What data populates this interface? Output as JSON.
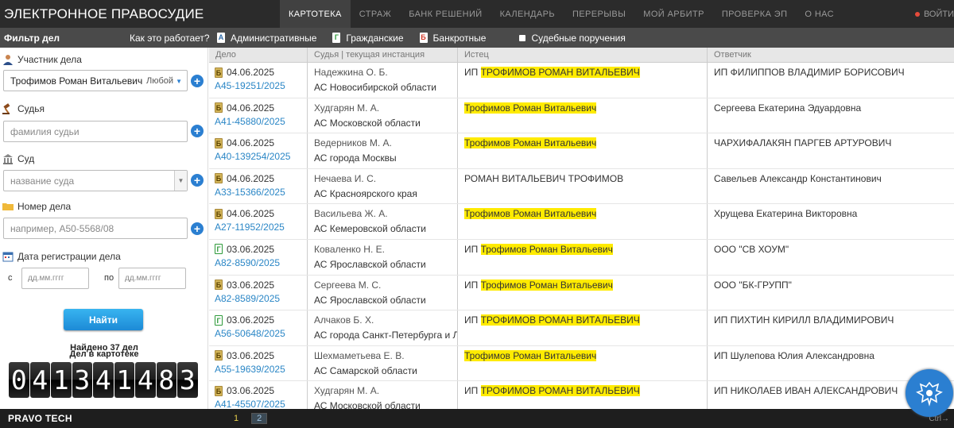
{
  "header": {
    "brand": "ЭЛЕКТРОННОЕ ПРАВОСУДИЕ",
    "nav": [
      "КАРТОТЕКА",
      "СТРАЖ",
      "БАНК РЕШЕНИЙ",
      "КАЛЕНДАРЬ",
      "ПЕРЕРЫВЫ",
      "МОЙ АРБИТР",
      "ПРОВЕРКА ЭП",
      "О НАС"
    ],
    "exit": "ВОЙТИ"
  },
  "filterbar": {
    "title": "Фильтр дел",
    "how": "Как это работает?",
    "cats": [
      {
        "icon": "А",
        "label": "Административные"
      },
      {
        "icon": "Г",
        "label": "Гражданские"
      },
      {
        "icon": "Б",
        "label": "Банкротные"
      },
      {
        "icon": "",
        "label": "Судебные поручения"
      }
    ]
  },
  "side": {
    "participant_label": "Участник дела",
    "participant_value": "Трофимов Роман Витальевич",
    "participant_role": "Любой",
    "judge_label": "Судья",
    "judge_placeholder": "фамилия судьи",
    "court_label": "Суд",
    "court_placeholder": "название суда",
    "number_label": "Номер дела",
    "number_placeholder": "например, А50-5568/08",
    "date_label": "Дата регистрации дела",
    "from": "с",
    "to": "по",
    "date_placeholder": "дд.мм.гггг",
    "find": "Найти",
    "found": "Найдено 37 дел",
    "card": "Дел в картотеке",
    "counter": [
      "0",
      "4",
      "1",
      "3",
      "4",
      "1",
      "4",
      "8",
      "3"
    ]
  },
  "table": {
    "columns": [
      "Дело",
      "Судья | текущая инстанция",
      "Истец",
      "Ответчик"
    ],
    "rows": [
      {
        "type": "Б",
        "date": "04.06.2025",
        "num": "А45-19251/2025",
        "judge": "Надежкина О. Б.",
        "court": "АС Новосибирской области",
        "plaintiff_pre": "ИП ",
        "plaintiff_hl": "ТРОФИМОВ РОМАН ВИТАЛЬЕВИЧ",
        "plaintiff_post": "",
        "defendant": "ИП ФИЛИППОВ ВЛАДИМИР БОРИСОВИЧ"
      },
      {
        "type": "Б",
        "date": "04.06.2025",
        "num": "А41-45880/2025",
        "judge": "Худгарян М. А.",
        "court": "АС Московской области",
        "plaintiff_pre": "",
        "plaintiff_hl": "Трофимов Роман Витальевич",
        "plaintiff_post": "",
        "defendant": "Сергеева Екатерина Эдуардовна"
      },
      {
        "type": "Б",
        "date": "04.06.2025",
        "num": "А40-139254/2025",
        "judge": "Ведерников М. А.",
        "court": "АС города Москвы",
        "plaintiff_pre": "",
        "plaintiff_hl": "Трофимов Роман Витальевич",
        "plaintiff_post": "",
        "defendant": "ЧАРХИФАЛАКЯН ПАРГЕВ АРТУРОВИЧ"
      },
      {
        "type": "Б",
        "date": "04.06.2025",
        "num": "А33-15366/2025",
        "judge": "Нечаева И. С.",
        "court": "АС Красноярского края",
        "plaintiff_pre": "РОМАН ВИТАЛЬЕВИЧ ТРОФИМОВ",
        "plaintiff_hl": "",
        "plaintiff_post": "",
        "defendant": "Савельев Александр Константинович"
      },
      {
        "type": "Б",
        "date": "04.06.2025",
        "num": "А27-11952/2025",
        "judge": "Васильева Ж. А.",
        "court": "АС Кемеровской области",
        "plaintiff_pre": "",
        "plaintiff_hl": "Трофимов Роман Витальевич",
        "plaintiff_post": "",
        "defendant": "Хрущева Екатерина Викторовна"
      },
      {
        "type": "Г",
        "date": "03.06.2025",
        "num": "А82-8590/2025",
        "judge": "Коваленко Н. Е.",
        "court": "АС Ярославской области",
        "plaintiff_pre": "ИП ",
        "plaintiff_hl": "Трофимов Роман Витальевич",
        "plaintiff_post": "",
        "defendant": "ООО \"СВ ХОУМ\""
      },
      {
        "type": "Б",
        "date": "03.06.2025",
        "num": "А82-8589/2025",
        "judge": "Сергеева М. С.",
        "court": "АС Ярославской области",
        "plaintiff_pre": "ИП ",
        "plaintiff_hl": "Трофимов Роман Витальевич",
        "plaintiff_post": "",
        "defendant": "ООО \"БК-ГРУПП\""
      },
      {
        "type": "Г",
        "date": "03.06.2025",
        "num": "А56-50648/2025",
        "judge": "Алчаков Б. Х.",
        "court": "АС города Санкт-Петербурга и Ленинградской области",
        "plaintiff_pre": "ИП ",
        "plaintiff_hl": "ТРОФИМОВ РОМАН ВИТАЛЬЕВИЧ",
        "plaintiff_post": "",
        "defendant": "ИП ПИХТИН КИРИЛЛ ВЛАДИМИРОВИЧ"
      },
      {
        "type": "Б",
        "date": "03.06.2025",
        "num": "А55-19639/2025",
        "judge": "Шехмаметьева Е. В.",
        "court": "АС Самарской области",
        "plaintiff_pre": "",
        "plaintiff_hl": "Трофимов Роман Витальевич",
        "plaintiff_post": "",
        "defendant": "ИП Шулепова Юлия Александровна"
      },
      {
        "type": "Б",
        "date": "03.06.2025",
        "num": "А41-45507/2025",
        "judge": "Худгарян М. А.",
        "court": "АС Московской области",
        "plaintiff_pre": "ИП ",
        "plaintiff_hl": "ТРОФИМОВ РОМАН ВИТАЛЬЕВИЧ",
        "plaintiff_post": "",
        "defendant": "ИП НИКОЛАЕВ ИВАН АЛЕКСАНДРОВИЧ"
      }
    ]
  },
  "footer": {
    "logo": "PRAVO TECH",
    "pages": [
      "1",
      "2"
    ],
    "ctrl": "Ctrl→"
  }
}
